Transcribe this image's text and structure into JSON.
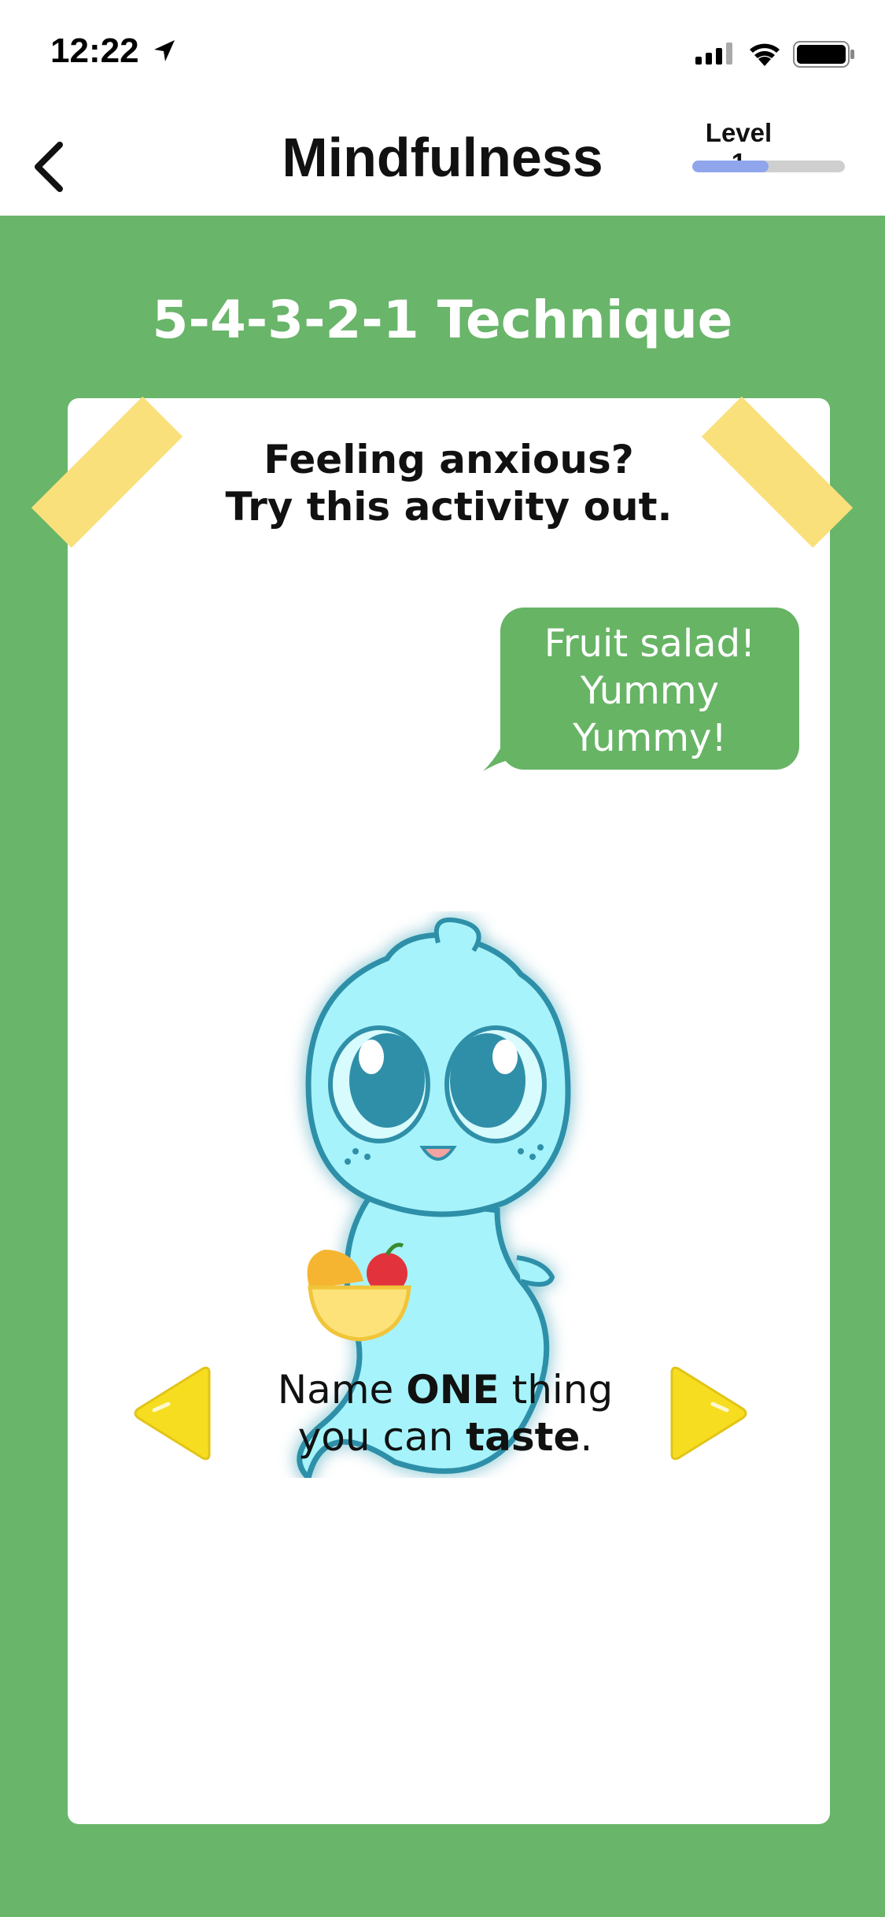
{
  "status_bar": {
    "time": "12:22",
    "location_icon": "location-arrow-icon",
    "signal_icon": "cellular-signal-icon",
    "wifi_icon": "wifi-icon",
    "battery_icon": "battery-icon"
  },
  "nav": {
    "back_icon": "chevron-left-icon",
    "title": "Mindfulness",
    "level_label": "Level 1",
    "level_progress_percent": 50
  },
  "activity": {
    "title": "5-4-3-2-1 Technique",
    "headline_line1": "Feeling anxious?",
    "headline_line2": "Try this activity out.",
    "bubble_line1": "Fruit salad!",
    "bubble_line2": "Yummy",
    "bubble_line3": "Yummy!",
    "prompt_line1_a": "Name ",
    "prompt_line1_b": "ONE",
    "prompt_line1_c": " thing",
    "prompt_line2_a": "you can ",
    "prompt_line2_b": "taste",
    "prompt_line2_c": ".",
    "prev_icon": "triangle-left-icon",
    "next_icon": "triangle-right-icon",
    "mascot_icon": "ghost-mascot-with-fruit-bowl-icon"
  },
  "colors": {
    "background_green": "#69b56a",
    "bubble_green": "#67b465",
    "tape_yellow": "#f9e07a",
    "arrow_yellow": "#f7dd20",
    "progress_blue": "#8fa5ec",
    "mascot_cyan": "#a6f3fb"
  }
}
